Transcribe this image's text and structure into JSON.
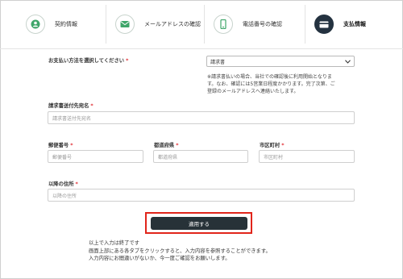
{
  "steps": [
    {
      "label": "契約情報",
      "icon": "person-icon",
      "active": false
    },
    {
      "label": "メールアドレスの確認",
      "icon": "envelope-icon",
      "active": false
    },
    {
      "label": "電話番号の確認",
      "icon": "phone-icon",
      "active": false
    },
    {
      "label": "支払情報",
      "icon": "card-icon",
      "active": true
    }
  ],
  "colors": {
    "accent_green": "#3fa66a",
    "dark": "#273238",
    "required": "#e0282e",
    "highlight": "#e1251b"
  },
  "form": {
    "payment_method": {
      "label": "お支払い方法を選択してください",
      "required_mark": "*",
      "selected": "請求書",
      "note_lines": [
        "※請求書払いの場合、当社での確認後に利用開始となりま",
        "す。なお、確認には5営業日程度かかります。完了次第、ご",
        "登録のメールアドレスへ連絡いたします。"
      ]
    },
    "invoice_name": {
      "label": "請求書送付先宛名",
      "required_mark": "*",
      "placeholder": "請求書送付先宛名"
    },
    "postal_code": {
      "label": "郵便番号",
      "required_mark": "*",
      "placeholder": "郵便番号"
    },
    "prefecture": {
      "label": "都道府県",
      "required_mark": "*",
      "placeholder": "都道府県"
    },
    "city": {
      "label": "市区町村",
      "required_mark": "*",
      "placeholder": "市区町村"
    },
    "address": {
      "label": "以降の住所",
      "required_mark": "*",
      "placeholder": "以降の住所"
    }
  },
  "submit": {
    "label": "適用する"
  },
  "footer_lines": [
    "以上で入力は終了です",
    "画面上部にある各タブをクリックすると、入力内容を参照することができます。",
    "入力内容にお間違いがないか、今一度ご確認をお願いします。"
  ]
}
